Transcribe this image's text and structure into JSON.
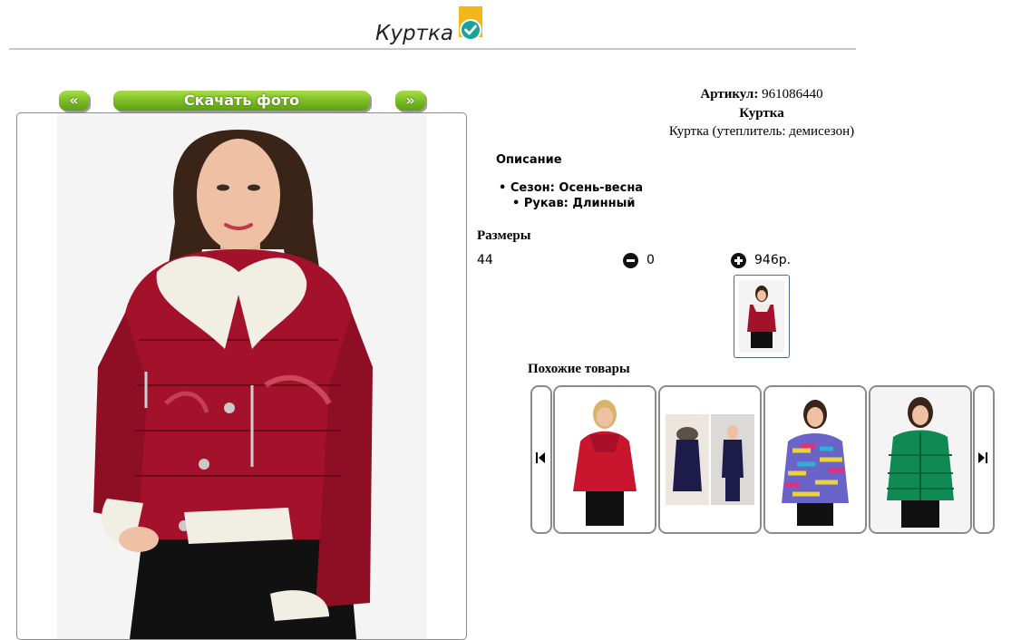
{
  "header": {
    "title": "Куртка"
  },
  "photo_nav": {
    "prev_label": "«",
    "download_label": "Скачать фото",
    "next_label": "»"
  },
  "product": {
    "article_label": "Артикул:",
    "article_value": "961086440",
    "name": "Куртка",
    "subtitle": "Куртка (утеплитель: демисезон)"
  },
  "description": {
    "heading": "Описание",
    "specs": [
      {
        "label": "Сезон:",
        "value": "Осень-весна"
      },
      {
        "label": "Рукав:",
        "value": "Длинный"
      }
    ]
  },
  "sizes": {
    "heading": "Размеры",
    "rows": [
      {
        "size": "44",
        "quantity": "0",
        "price": "946р."
      }
    ]
  },
  "similar": {
    "heading": "Похожие товары"
  },
  "colors": {
    "accent_green": "#7fc126",
    "jacket_red": "#a3122a",
    "badge_yellow": "#f3b71c",
    "badge_teal": "#1aa39a"
  },
  "icons": {
    "title_badge": "check-badge-icon",
    "decrease": "minus-circle-icon",
    "increase": "plus-circle-icon",
    "carousel_prev": "skip-back-icon",
    "carousel_next": "skip-forward-icon"
  }
}
